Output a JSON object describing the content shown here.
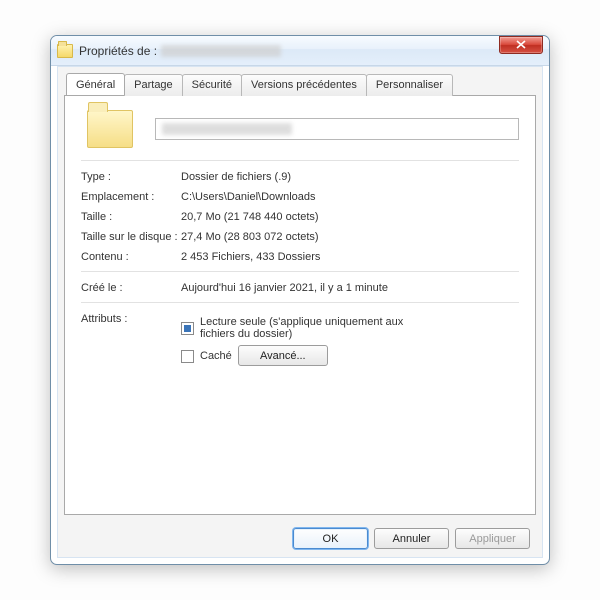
{
  "title": {
    "prefix": "Propriétés de :",
    "name_obscured": true
  },
  "tabs": [
    {
      "label": "Général",
      "active": true
    },
    {
      "label": "Partage",
      "active": false
    },
    {
      "label": "Sécurité",
      "active": false
    },
    {
      "label": "Versions précédentes",
      "active": false
    },
    {
      "label": "Personnaliser",
      "active": false
    }
  ],
  "general": {
    "name_obscured": true,
    "type_label": "Type :",
    "type_value": "Dossier de fichiers (.9)",
    "location_label": "Emplacement :",
    "location_value": "C:\\Users\\Daniel\\Downloads",
    "size_label": "Taille :",
    "size_value": "20,7 Mo (21 748 440 octets)",
    "size_on_disk_label": "Taille sur le disque :",
    "size_on_disk_value": "27,4 Mo (28 803 072 octets)",
    "contents_label": "Contenu :",
    "contents_value": "2 453 Fichiers, 433 Dossiers",
    "created_label": "Créé le :",
    "created_value": "Aujourd'hui 16 janvier 2021, il y a 1 minute",
    "attributes_label": "Attributs :",
    "readonly_label": "Lecture seule (s'applique uniquement aux fichiers du dossier)",
    "readonly_state": "filled",
    "hidden_label": "Caché",
    "hidden_state": "unchecked",
    "advanced_button": "Avancé..."
  },
  "buttons": {
    "ok": "OK",
    "cancel": "Annuler",
    "apply": "Appliquer"
  }
}
